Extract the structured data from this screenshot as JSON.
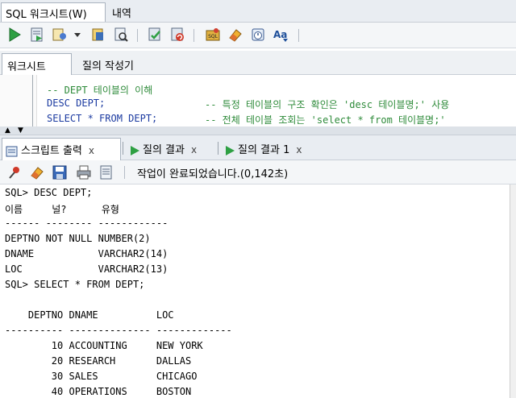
{
  "top_tabs": {
    "worksheet": "SQL 워크시트(W)",
    "history": "내역"
  },
  "sub_tabs": {
    "worksheet": "워크시트",
    "query_builder": "질의 작성기"
  },
  "editor": {
    "line1": "-- DEPT 테이블의 이해",
    "line2_code": "DESC DEPT;",
    "line2_comment": "-- 특정 테이블의 구조 확인은 'desc 테이블명;' 사용",
    "line3_code": "SELECT * FROM DEPT;",
    "line3_comment": "-- 전체 테이블 조회는 'select * from 테이블명;'"
  },
  "output_tabs": {
    "script_output": "스크립트 출력",
    "query_result": "질의 결과",
    "query_result_1": "질의 결과 1",
    "close": "x"
  },
  "output_toolbar": {
    "status": "작업이 완료되었습니다.(0,142초)"
  },
  "output_lines": [
    "SQL> DESC DEPT;",
    "이름     널?      유형",
    "------ -------- ------------",
    "DEPTNO NOT NULL NUMBER(2)",
    "DNAME           VARCHAR2(14)",
    "LOC             VARCHAR2(13)",
    "SQL> SELECT * FROM DEPT;",
    "",
    "    DEPTNO DNAME          LOC",
    "---------- -------------- -------------",
    "        10 ACCOUNTING     NEW YORK",
    "        20 RESEARCH       DALLAS",
    "        30 SALES          CHICAGO",
    "        40 OPERATIONS     BOSTON"
  ],
  "icons": {
    "run": "run-statement-icon",
    "run_script": "run-script-icon",
    "autotrace": "autotrace-icon",
    "explain": "explain-plan-icon",
    "sql_tuning": "sql-tuning-icon",
    "commit": "commit-icon",
    "rollback": "rollback-icon",
    "sql_history": "sql-history-icon",
    "clear": "clear-eraser-icon",
    "timer": "timer-icon",
    "case": "change-case-icon"
  },
  "colors": {
    "keyword": "#1b3aa0",
    "comment": "#2e8b3a",
    "run_green": "#2ea043"
  }
}
